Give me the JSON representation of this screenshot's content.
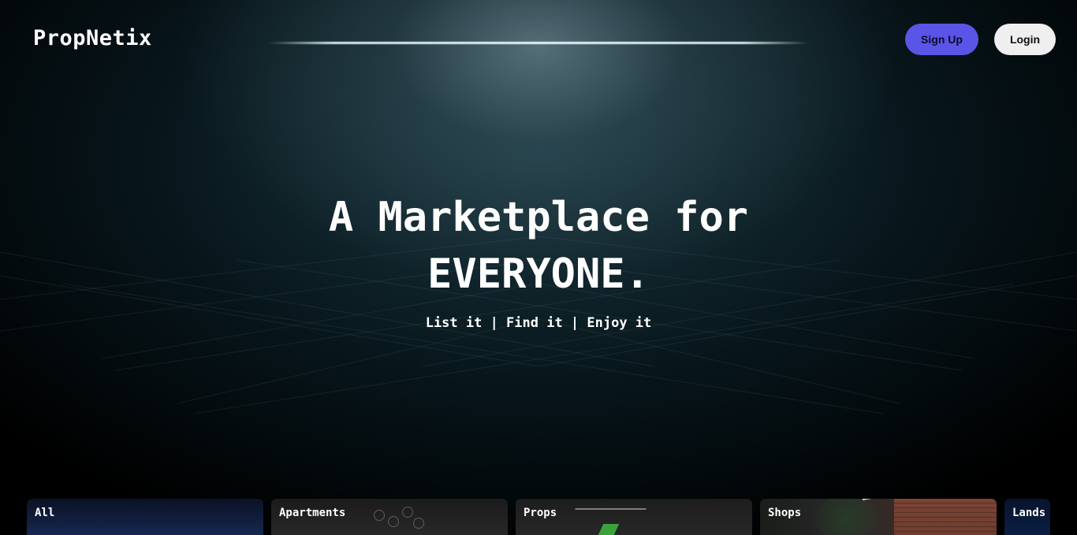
{
  "header": {
    "brand": "PropNetix",
    "signup_label": "Sign Up",
    "login_label": "Login"
  },
  "hero": {
    "title_line1": "A Marketplace for",
    "title_line2": "EVERYONE.",
    "subtitle": "List it | Find it | Enjoy it"
  },
  "categories": [
    {
      "label": "All"
    },
    {
      "label": "Apartments"
    },
    {
      "label": "Props"
    },
    {
      "label": "Shops"
    },
    {
      "label": "Lands"
    }
  ],
  "colors": {
    "signup_button": "#5a55e6",
    "login_button": "#efefef",
    "background": "#000000"
  }
}
